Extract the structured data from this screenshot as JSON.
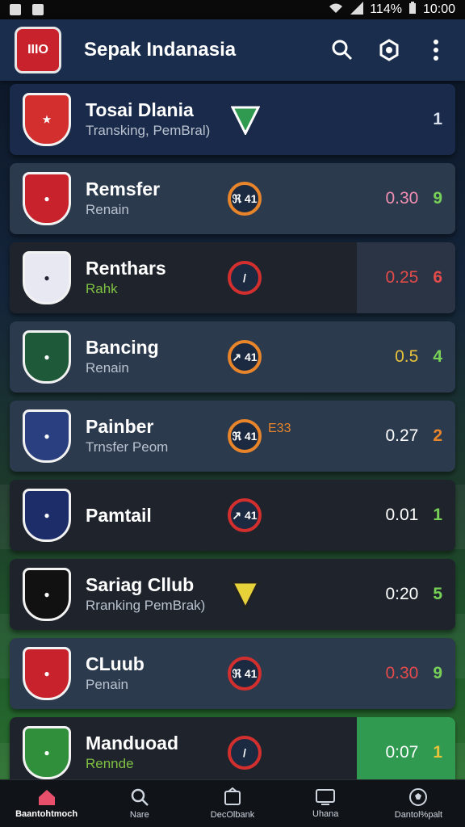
{
  "status": {
    "battery": "114%",
    "time": "10:00"
  },
  "app": {
    "title": "Sepak Indanasia",
    "logo_text": "IIIO"
  },
  "header_icons": [
    "search-icon",
    "settings-icon",
    "more-vert-icon"
  ],
  "colors": {
    "accent_orange": "#e8852a",
    "accent_red": "#d32f2f",
    "appbar": "#1b2d4d",
    "highlight_green": "#2f9a50"
  },
  "teams": [
    {
      "name": "Tosai Dlania",
      "sub": "Transking, PemBral)",
      "badge": "",
      "value": "",
      "rank": "1",
      "value_color": "#ffffff",
      "rank_color": "#d9e1ee",
      "crest_color": "#d32f2f"
    },
    {
      "name": "Remsfer",
      "sub": "Renain",
      "badge": "ℜ 41",
      "value": "0.30",
      "rank": "9",
      "value_color": "#f08fb2",
      "rank_color": "#77d157",
      "crest_color": "#c8232c"
    },
    {
      "name": "Renthars",
      "sub": "Rahk",
      "badge": "",
      "value": "0.25",
      "rank": "6",
      "value_color": "#e34b4b",
      "rank_color": "#e34b4b",
      "crest_color": "#e8e8f3"
    },
    {
      "name": "Bancing",
      "sub": "Renain",
      "badge": "↗ 41",
      "value": "0.5",
      "rank": "4",
      "value_color": "#e8c23a",
      "rank_color": "#77d157",
      "crest_color": "#1e5a3a"
    },
    {
      "name": "Painber",
      "sub": "Trnsfer Peom",
      "badge": "ℜ 41",
      "extra": "E33",
      "value": "0.27",
      "rank": "2",
      "value_color": "#ffffff",
      "rank_color": "#e8852a",
      "crest_color": "#2a3f80"
    },
    {
      "name": "Pamtail",
      "sub": "",
      "badge": "↗ 41",
      "value": "0.01",
      "rank": "1",
      "value_color": "#ffffff",
      "rank_color": "#77d157",
      "crest_color": "#1c2d6a"
    },
    {
      "name": "Sariag Cllub",
      "sub": "Rranking PemBrak)",
      "badge": "",
      "value": "0:20",
      "rank": "5",
      "value_color": "#ffffff",
      "rank_color": "#77d157",
      "crest_color": "#111111"
    },
    {
      "name": "CLuub",
      "sub": "Penain",
      "badge": "ℜ 41",
      "value": "0.30",
      "rank": "9",
      "value_color": "#e34b4b",
      "rank_color": "#77d157",
      "crest_color": "#c8232c"
    },
    {
      "name": "Manduoad",
      "sub": "Rennde",
      "badge": "",
      "value": "0:07",
      "rank": "1",
      "value_color": "#ffffff",
      "rank_color": "#e8c23a",
      "crest_color": "#2f8f3a"
    }
  ],
  "nav": [
    {
      "label": "Baantohtmoch",
      "icon": "home-icon"
    },
    {
      "label": "Nare",
      "icon": "search-icon"
    },
    {
      "label": "DecOlbank",
      "icon": "transfer-icon"
    },
    {
      "label": "Uhana",
      "icon": "tv-icon"
    },
    {
      "label": "Dantol%palt",
      "icon": "soccer-ball-icon"
    }
  ]
}
